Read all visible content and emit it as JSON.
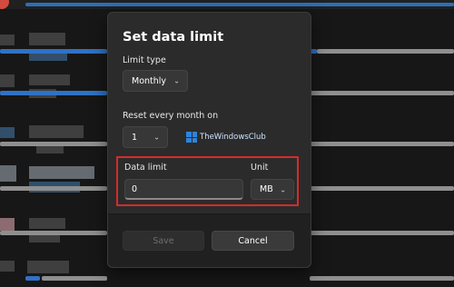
{
  "dialog": {
    "title": "Set data limit",
    "limit_type": {
      "label": "Limit type",
      "value": "Monthly"
    },
    "reset": {
      "label": "Reset every month on",
      "value": "1"
    },
    "data_limit": {
      "label": "Data limit",
      "value": "0"
    },
    "unit": {
      "label": "Unit",
      "value": "MB"
    },
    "buttons": {
      "save": "Save",
      "cancel": "Cancel"
    }
  },
  "watermark": "TheWindowsClub",
  "icons": {
    "dropdown": "chevron-down-icon",
    "logo": "windows-logo-icon"
  },
  "colors": {
    "accent": "#2f72c5",
    "highlight": "#d62b2b",
    "background": "#1b1b1b"
  }
}
